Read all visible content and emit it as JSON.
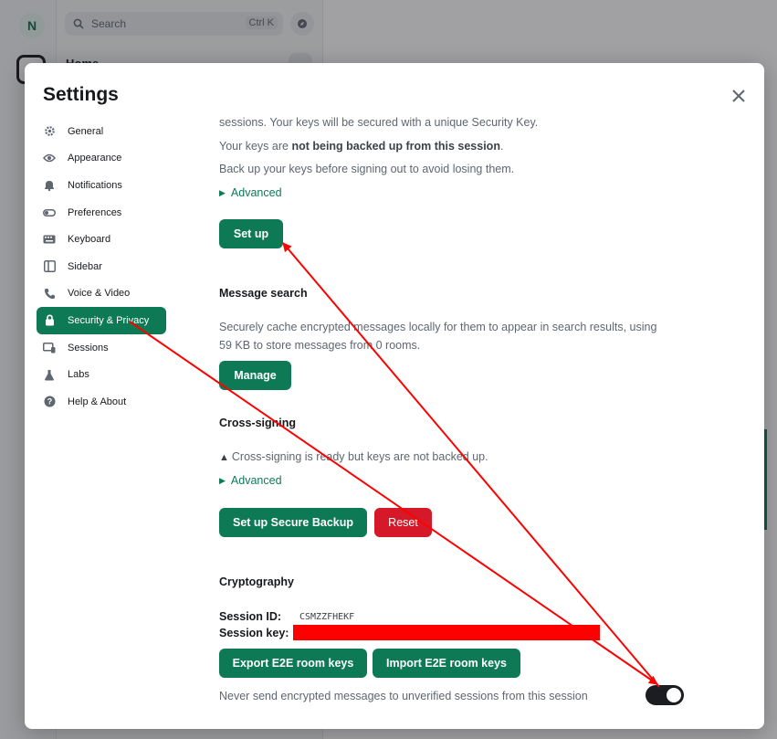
{
  "background": {
    "avatar_letter": "N",
    "search_placeholder": "Search",
    "search_shortcut": "Ctrl K",
    "home_label": "Home"
  },
  "dialog": {
    "title": "Settings",
    "close_icon": "close-icon"
  },
  "nav": {
    "items": [
      {
        "label": "General",
        "icon": "gear-icon"
      },
      {
        "label": "Appearance",
        "icon": "eye-icon"
      },
      {
        "label": "Notifications",
        "icon": "bell-icon"
      },
      {
        "label": "Preferences",
        "icon": "toggle-icon"
      },
      {
        "label": "Keyboard",
        "icon": "keyboard-icon"
      },
      {
        "label": "Sidebar",
        "icon": "sidebar-icon"
      },
      {
        "label": "Voice & Video",
        "icon": "phone-icon"
      },
      {
        "label": "Security & Privacy",
        "icon": "lock-icon",
        "active": true
      },
      {
        "label": "Sessions",
        "icon": "devices-icon"
      },
      {
        "label": "Labs",
        "icon": "flask-icon"
      },
      {
        "label": "Help & About",
        "icon": "help-icon"
      }
    ]
  },
  "backup": {
    "line1": "sessions. Your keys will be secured with a unique Security Key.",
    "line2_prefix": "Your keys are ",
    "line2_bold": "not being backed up from this session",
    "line2_suffix": ".",
    "line3": "Back up your keys before signing out to avoid losing them.",
    "advanced_label": "Advanced",
    "setup_button": "Set up"
  },
  "message_search": {
    "heading": "Message search",
    "line1": "Securely cache encrypted messages locally for them to appear in search results, using",
    "line2": "59 KB to store messages from 0 rooms.",
    "manage_button": "Manage"
  },
  "cross_signing": {
    "heading": "Cross-signing",
    "status": "Cross-signing is ready but keys are not backed up.",
    "advanced_label": "Advanced",
    "secure_backup_button": "Set up Secure Backup",
    "reset_button": "Reset"
  },
  "cryptography": {
    "heading": "Cryptography",
    "session_id_label": "Session ID:",
    "session_id_value": "CSMZZFHEKF",
    "session_key_label": "Session key:",
    "export_button": "Export E2E room keys",
    "import_button": "Import E2E room keys",
    "never_send_label": "Never send encrypted messages to unverified sessions from this session",
    "never_send_enabled": true
  },
  "colors": {
    "accent": "#0e7a55",
    "danger": "#d51928",
    "annotation": "#ff0000"
  }
}
